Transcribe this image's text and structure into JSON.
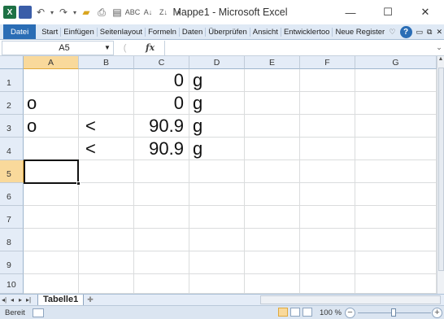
{
  "titlebar": {
    "title": "Mappe1 - Microsoft Excel",
    "minimize_glyph": "—",
    "maximize_glyph": "☐",
    "close_glyph": "✕"
  },
  "quick_access": {
    "app_icon": "excel-icon",
    "items": [
      "save-icon",
      "undo-icon",
      "redo-icon",
      "open-icon",
      "print-icon",
      "print-preview-icon",
      "spellcheck-icon",
      "sort-ascending-icon",
      "sort-descending-icon",
      "customize-icon"
    ]
  },
  "ribbon": {
    "file_tab": "Datei",
    "tabs": [
      "Start",
      "Einfügen",
      "Seitenlayout",
      "Formeln",
      "Daten",
      "Überprüfen",
      "Ansicht",
      "Entwicklertoo",
      "Neue Register"
    ],
    "help_glyph": "?"
  },
  "formula_bar": {
    "name_box": "A5",
    "fx_label": "fx",
    "formula": ""
  },
  "grid": {
    "columns": [
      "A",
      "B",
      "C",
      "D",
      "E",
      "F",
      "G"
    ],
    "rows": [
      "1",
      "2",
      "3",
      "4",
      "5",
      "6",
      "7",
      "8",
      "9",
      "10"
    ],
    "selected_column": "A",
    "selected_row": "5",
    "cells": {
      "A2": "o",
      "C2": "0",
      "D2": "g",
      "C1": "0",
      "D1": "g",
      "A3": "o",
      "B3": "<",
      "C3": "90.9",
      "D3": "g",
      "B4": "<",
      "C4": "90.9",
      "D4": "g"
    }
  },
  "sheets": {
    "active": "Tabelle1"
  },
  "statusbar": {
    "status": "Bereit",
    "zoom": "100 %",
    "zoom_minus": "−",
    "zoom_plus": "+"
  },
  "colors": {
    "accent": "#2a6db5",
    "header_selected": "#f9d99b"
  }
}
